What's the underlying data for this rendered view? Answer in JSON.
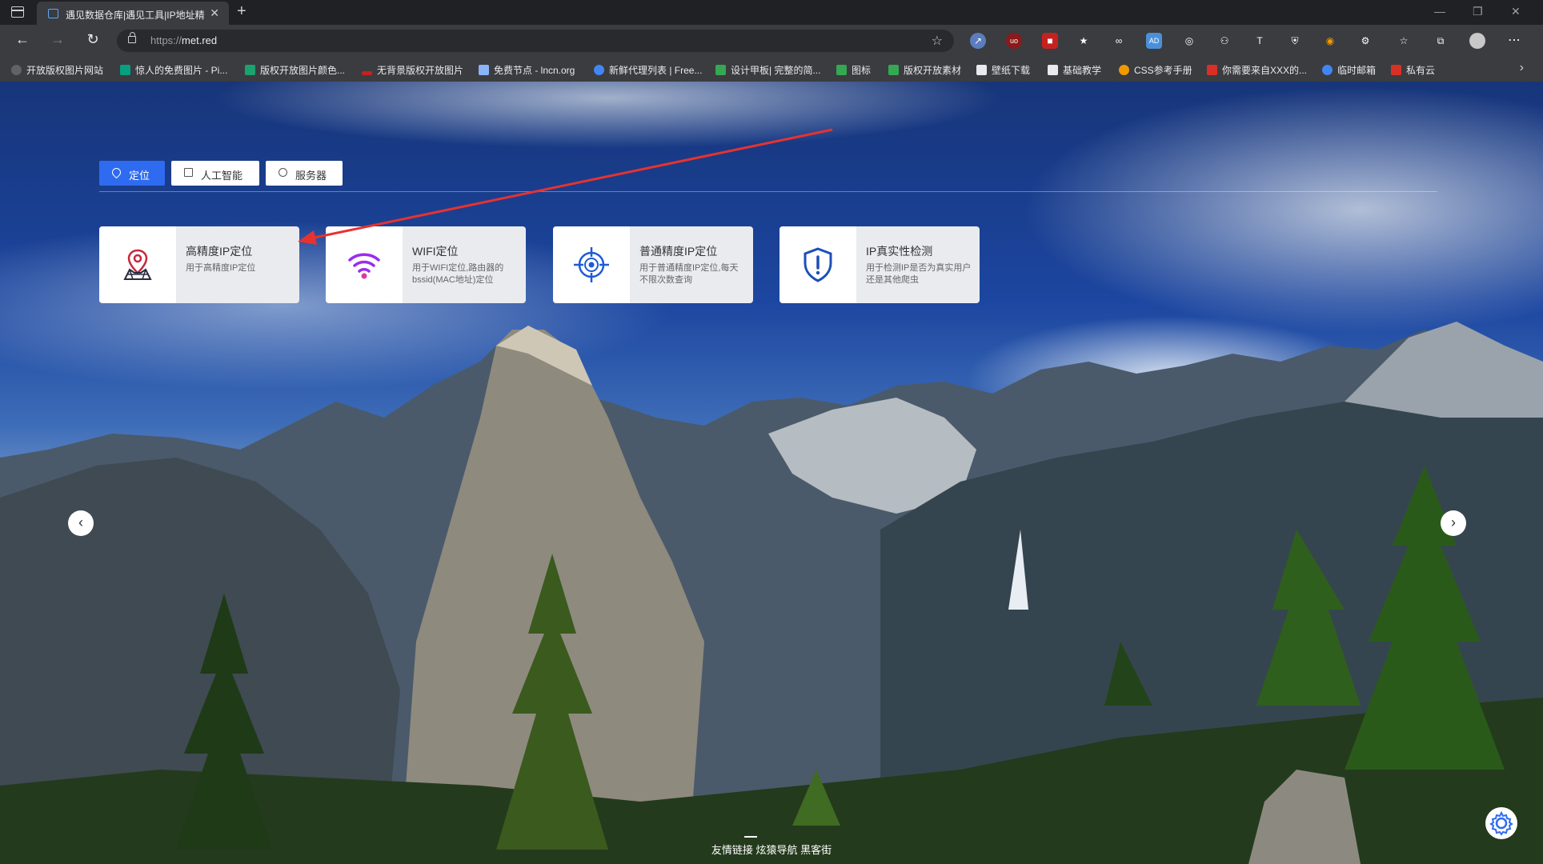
{
  "browser": {
    "tab_title": "遇见数据仓库|遇见工具|IP地址精",
    "url_scheme": "https://",
    "url_host": "met.red",
    "bookmarks": [
      {
        "label": "开放版权图片网站",
        "color": "#5f6368"
      },
      {
        "label": "惊人的免费图片 - Pi...",
        "color": "#05a081"
      },
      {
        "label": "版权开放图片颜色...",
        "color": "#1aa36f"
      },
      {
        "label": "无背景版权开放图片",
        "color": "#c5221f"
      },
      {
        "label": "免费节点 - lncn.org",
        "color": "#8ab4f8"
      },
      {
        "label": "新鲜代理列表 | Free...",
        "color": "#4285f4"
      },
      {
        "label": "设计甲板| 完整的简...",
        "color": "#34a853"
      },
      {
        "label": "图标",
        "color": "#34a853"
      },
      {
        "label": "版权开放素材",
        "color": "#34a853"
      },
      {
        "label": "壁纸下载",
        "color": "#e8eaed"
      },
      {
        "label": "基础教学",
        "color": "#e8eaed"
      },
      {
        "label": "CSS参考手册",
        "color": "#f29900"
      },
      {
        "label": "你需要来自XXX的...",
        "color": "#d93025"
      },
      {
        "label": "临时邮箱",
        "color": "#4285f4"
      },
      {
        "label": "私有云",
        "color": "#d93025"
      }
    ]
  },
  "page": {
    "tabs": [
      {
        "label": "定位",
        "active": true
      },
      {
        "label": "人工智能",
        "active": false
      },
      {
        "label": "服务器",
        "active": false
      }
    ],
    "cards": [
      {
        "title": "高精度IP定位",
        "desc": "用于高精度IP定位",
        "icon": "map-pin-icon"
      },
      {
        "title": "WIFI定位",
        "desc": "用于WIFI定位,路由器的bssid(MAC地址)定位",
        "icon": "wifi-icon"
      },
      {
        "title": "普通精度IP定位",
        "desc": "用于普通精度IP定位,每天不限次数查询",
        "icon": "crosshair-icon"
      },
      {
        "title": "IP真实性检测",
        "desc": "用于检测IP是否为真实用户还是其他爬虫",
        "icon": "shield-alert-icon"
      }
    ],
    "footer_links": "友情链接  炫猿导航  黑客街",
    "colors": {
      "accent": "#2f6bf0",
      "purple": "#9b2cf0",
      "blue_icon": "#1d5bd8"
    }
  }
}
